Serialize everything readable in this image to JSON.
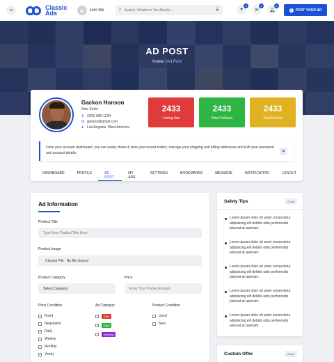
{
  "header": {
    "logo_line1": "Classic",
    "logo_line2": "Ads",
    "join_label": "Join Me",
    "search_placeholder": "Search, Whatever You Needs...",
    "badges": [
      "0",
      "0",
      "0"
    ],
    "post_button": "POST YOUR AD"
  },
  "hero": {
    "title": "AD POST",
    "crumb_home": "Home",
    "crumb_sep": "/",
    "crumb_current": "Ad Post"
  },
  "profile": {
    "name": "Gackon Honson",
    "role": "New Seller",
    "phone": "(123) 000-1234",
    "email": "gackon@gmail.com",
    "location": "Los Angeles, West America",
    "stats": [
      {
        "value": "2433",
        "label": "Listing Ads",
        "color": "#e03b3b"
      },
      {
        "value": "2433",
        "label": "Total Follower",
        "color": "#2fb543"
      },
      {
        "value": "2433",
        "label": "Total Review",
        "color": "#e0b120"
      }
    ],
    "note": "From your account dashboard. you can easily check & view your recent orders, manage your shipping and billing addresses and Edit your password and account details.",
    "tabs": [
      "DASHBOARD",
      "PROFILE",
      "AD POST",
      "MY ADS",
      "SETTINGS",
      "BOOKMARKS",
      "MESSAGE",
      "NOTIFICATION",
      "LOGOUT"
    ],
    "active_tab": "AD POST"
  },
  "ad_info": {
    "title": "Ad Information",
    "product_title_label": "Product Title",
    "product_title_placeholder": "Type Your Product Title Here",
    "product_image_label": "Product Image",
    "choose_file": "Choose File",
    "no_file": "No file chosen",
    "category_label": "Product Category",
    "category_value": "Select Category",
    "price_label": "Price",
    "price_placeholder": "Enter Your Pricing Amount",
    "price_condition_label": "Price Condition",
    "price_conditions": [
      "Fixed",
      "Negotiable",
      "Daily",
      "Weekly",
      "Monthly",
      "Yearly"
    ],
    "ad_category_label": "Ad Category",
    "ad_categories": [
      {
        "label": "Sale",
        "color": "#e03b3b"
      },
      {
        "label": "Rent",
        "color": "#2fb543"
      },
      {
        "label": "Booking",
        "color": "#8a2bd6"
      }
    ],
    "product_condition_label": "Product Condition",
    "product_conditions": [
      "Used",
      "New"
    ]
  },
  "safety": {
    "title": "Safety Tips",
    "close": "Close",
    "tips": [
      "Lorem ipsum dolor sit amet consectetur adipisicing elit debitis odio perferendis placeat at aperiam.",
      "Lorem ipsum dolor sit amet consectetur adipisicing elit debitis odio perferendis placeat at aperiam.",
      "Lorem ipsum dolor sit amet consectetur adipisicing elit debitis odio perferendis placeat at aperiam.",
      "Lorem ipsum dolor sit amet consectetur adipisicing elit debitis odio perferendis placeat at aperiam.",
      "Lorem ipsum dolor sit amet consectetur adipisicing elit debitis odio perferendis placeat at aperiam."
    ]
  },
  "custom_offer": {
    "title": "Custom Offer",
    "close": "Close"
  }
}
